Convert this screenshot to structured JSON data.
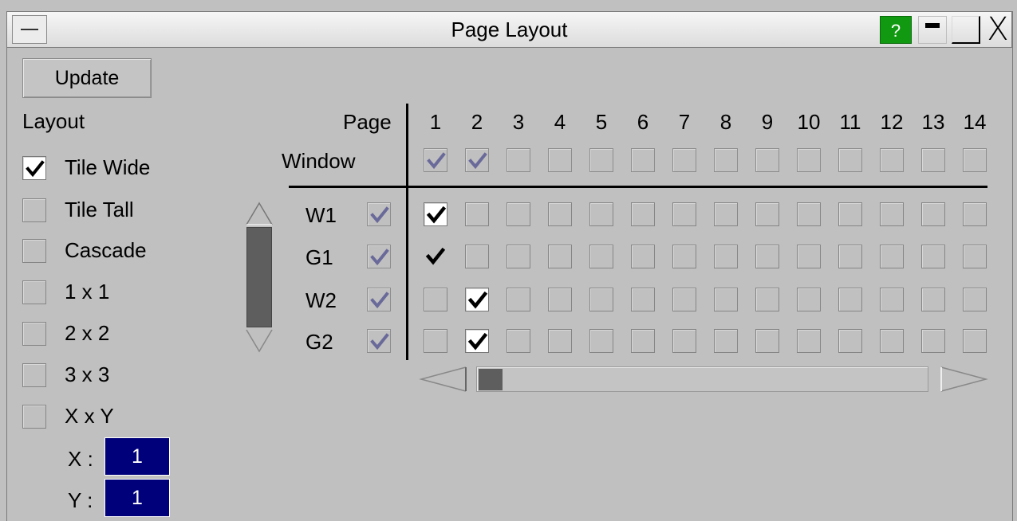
{
  "window": {
    "title": "Page Layout",
    "help_label": "?",
    "close_label": "X"
  },
  "toolbar": {
    "update_label": "Update"
  },
  "layout": {
    "heading": "Layout",
    "options": [
      {
        "label": "Tile Wide",
        "checked": true
      },
      {
        "label": "Tile Tall",
        "checked": false
      },
      {
        "label": "Cascade",
        "checked": false
      },
      {
        "label": "1 x 1",
        "checked": false
      },
      {
        "label": "2 x 2",
        "checked": false
      },
      {
        "label": "3 x 3",
        "checked": false
      },
      {
        "label": "X x Y",
        "checked": false
      }
    ],
    "x_label": "X :",
    "x_value": "1",
    "y_label": "Y :",
    "y_value": "1"
  },
  "grid": {
    "page_header": "Page",
    "window_header": "Window",
    "pages": [
      "1",
      "2",
      "3",
      "4",
      "5",
      "6",
      "7",
      "8",
      "9",
      "10",
      "11",
      "12",
      "13",
      "14"
    ],
    "window_row_checked": [
      true,
      true,
      false,
      false,
      false,
      false,
      false,
      false,
      false,
      false,
      false,
      false,
      false,
      false
    ],
    "rows": [
      {
        "label": "W1",
        "enabled": true,
        "checked_pages": [
          1
        ]
      },
      {
        "label": "G1",
        "enabled": true,
        "checked_pages": [
          1
        ]
      },
      {
        "label": "W2",
        "enabled": true,
        "checked_pages": [
          2
        ]
      },
      {
        "label": "G2",
        "enabled": true,
        "checked_pages": [
          2
        ]
      }
    ],
    "checked_cell_style": {
      "row0": "white-box",
      "row1": "no-box"
    }
  },
  "colors": {
    "background": "#c0c0c0",
    "help_button": "#119911",
    "input_bg": "#00007a",
    "dim_check": "#6a6a9a"
  }
}
